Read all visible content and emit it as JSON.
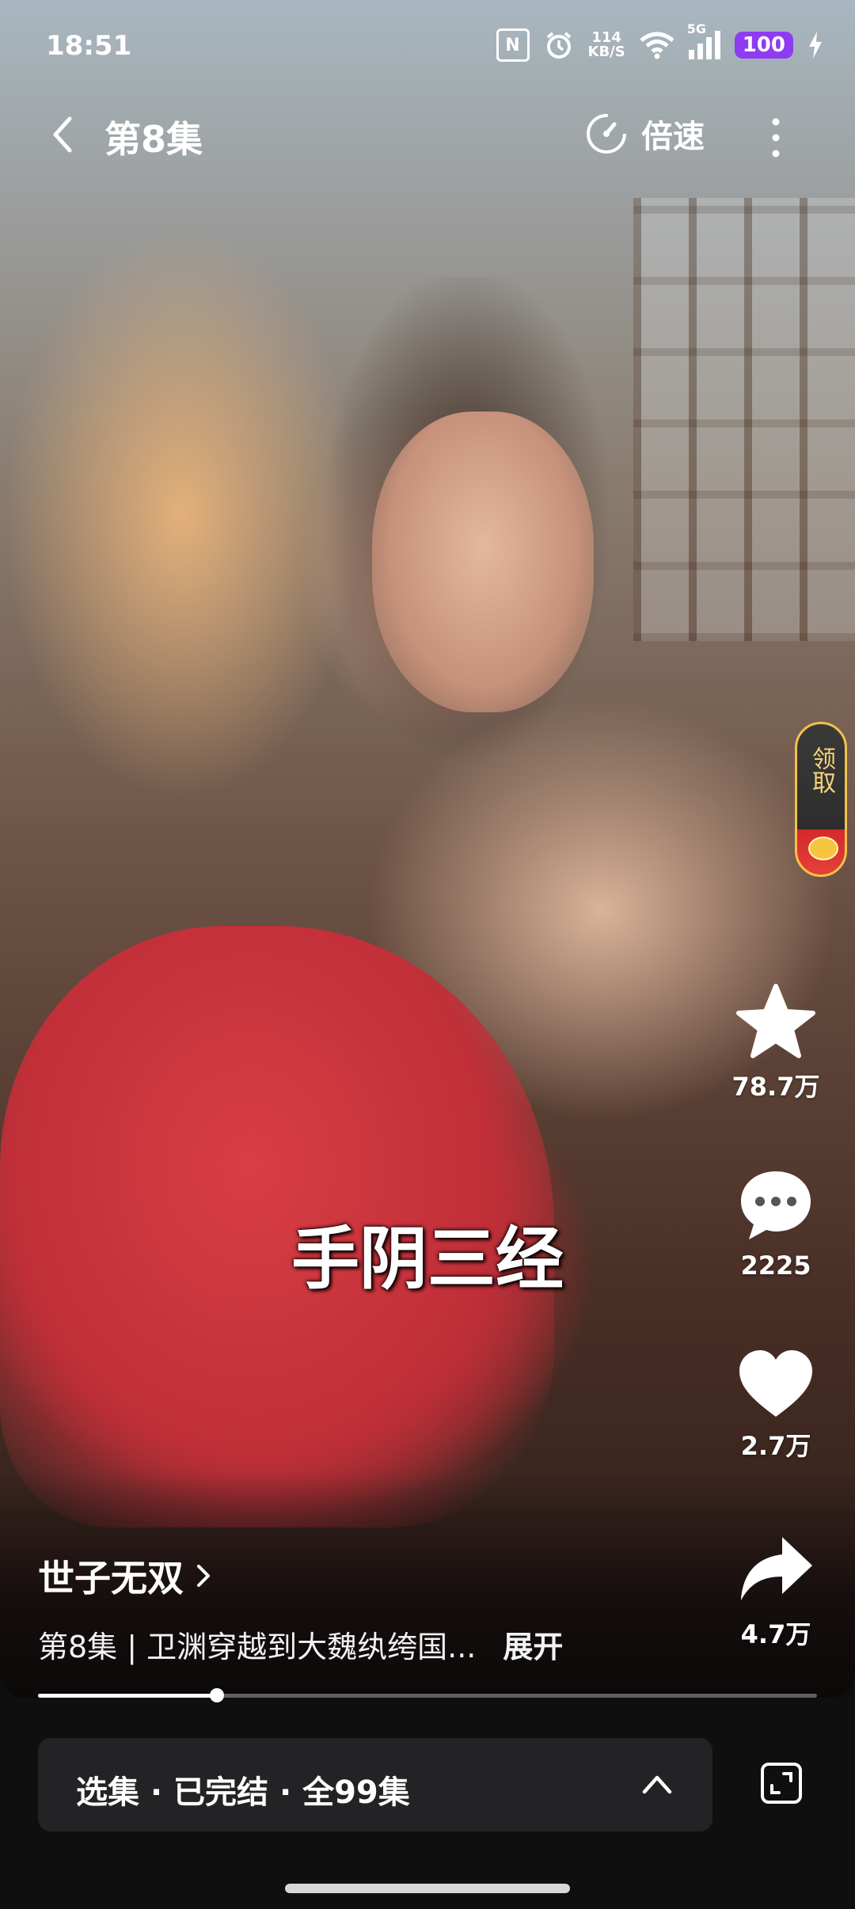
{
  "status_bar": {
    "time": "18:51",
    "net_speed": "114",
    "net_unit": "KB/S",
    "network": "5G",
    "battery": "100"
  },
  "header": {
    "title": "第8集",
    "speed_label": "倍速"
  },
  "gift_widget": {
    "label": "领取"
  },
  "actions": {
    "favorite_count": "78.7万",
    "comment_count": "2225",
    "like_count": "2.7万",
    "share_count": "4.7万"
  },
  "subtitle": "手阴三经",
  "info": {
    "show_title": "世子无双",
    "description": "第8集 | 卫渊穿越到大魏纨绔国...",
    "expand_label": "展开"
  },
  "progress": {
    "fraction": 0.23
  },
  "episode_bar": {
    "label": "选集 · 已完结 · 全99集"
  },
  "colors": {
    "accent_battery": "#8e3bf2",
    "gift_border": "#f1c24b"
  }
}
